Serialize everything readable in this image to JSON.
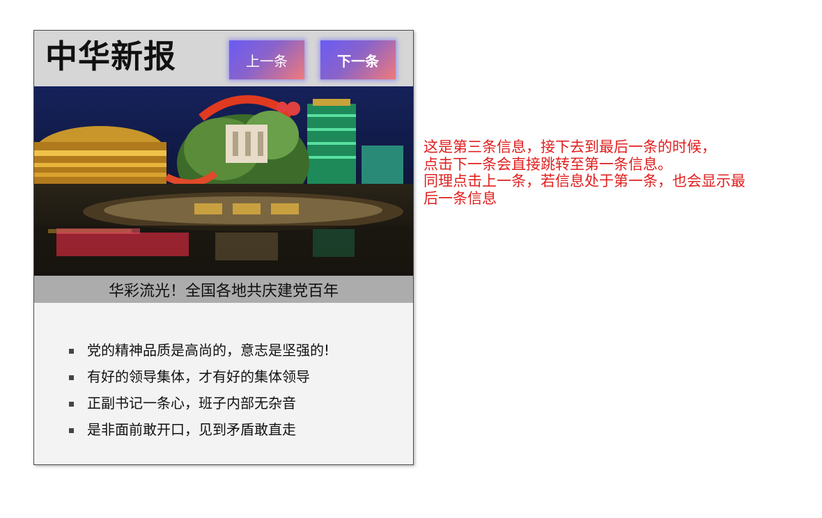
{
  "newspaper": {
    "title": "中华新报",
    "prev_label": "上一条",
    "next_label": "下一条"
  },
  "slide": {
    "image_alt": "华彩流光！全国各地共庆建党百年",
    "caption": "华彩流光！全国各地共庆建党百年"
  },
  "bullets": [
    "党的精神品质是高尚的，意志是坚强的!",
    "有好的领导集体，才有好的集体领导",
    "正副书记一条心，班子内部无杂音",
    "是非面前敢开口，见到矛盾敢直走"
  ],
  "note_lines": [
    "这是第三条信息，接下去到最后一条的时候，",
    "点击下一条会直接跳转至第一条信息。",
    "同理点击上一条，若信息处于第一条，也会显示最",
    "后一条信息"
  ],
  "colors": {
    "note_text": "#e02020",
    "header_bg": "#d6d6d6",
    "caption_bg": "#acacac",
    "button_gradient_start": "#6a5bf5",
    "button_gradient_end": "#f07a7a"
  }
}
